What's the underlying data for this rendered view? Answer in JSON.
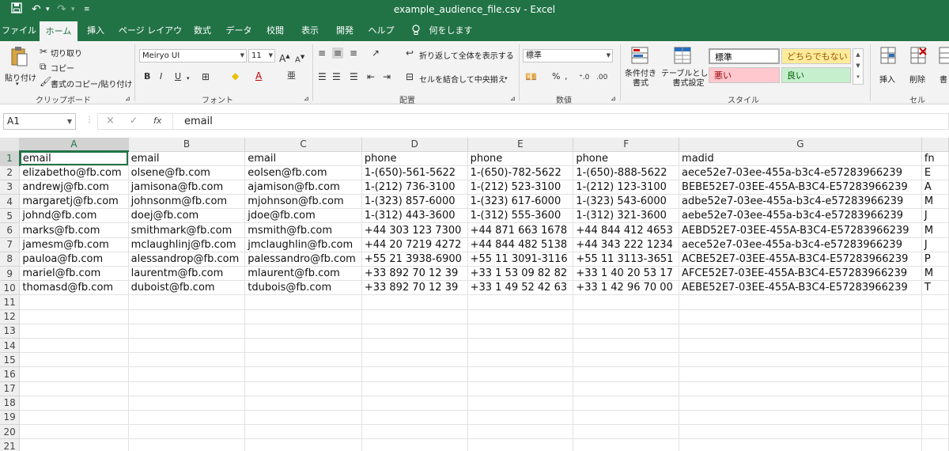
{
  "titlebar": {
    "save_icon": "save-icon",
    "undo_icon": "undo-icon",
    "redo_icon": "redo-icon",
    "title": "example_audience_file.csv  -  Excel"
  },
  "tabs": [
    "ファイル",
    "ホーム",
    "挿入",
    "ページ レイアウト",
    "数式",
    "データ",
    "校閲",
    "表示",
    "開発",
    "ヘルプ"
  ],
  "tellme": "何をしますか",
  "ribbon": {
    "clipboard": {
      "paste": "貼り付け",
      "cut": "切り取り",
      "copy": "コピー",
      "format_painter": "書式のコピー/貼り付け",
      "label": "クリップボード"
    },
    "font": {
      "name": "Meiryo UI",
      "size": "11",
      "bold": "B",
      "italic": "I",
      "underline": "U",
      "label": "フォント"
    },
    "alignment": {
      "wrap": "折り返して全体を表示する",
      "merge": "セルを結合して中央揃え",
      "label": "配置"
    },
    "number": {
      "format": "標準",
      "label": "数値"
    },
    "styles": {
      "conditional": "条件付き\n書式",
      "table": "テーブルとして\n書式設定",
      "normal": "標準",
      "neutral": "どちらでもない",
      "bad": "悪い",
      "good": "良い",
      "label": "スタイル"
    },
    "cells": {
      "insert": "挿入",
      "delete": "削除",
      "format": "書",
      "label": "セル"
    }
  },
  "formula": {
    "namebox": "A1",
    "cancel": "×",
    "enter": "✓",
    "fx": "fx",
    "value": "email"
  },
  "colors": {
    "accent": "#217346",
    "bad_bg": "#ffc7ce",
    "bad_fg": "#9c0006",
    "good_bg": "#c6efce",
    "good_fg": "#006100",
    "neutral_bg": "#ffeb9c",
    "neutral_fg": "#9c5700"
  },
  "grid": {
    "columns": [
      "A",
      "B",
      "C",
      "D",
      "E",
      "F",
      "G",
      ""
    ],
    "rows": [
      [
        "email",
        "email",
        "email",
        "phone",
        "phone",
        "phone",
        "madid",
        "fn"
      ],
      [
        "elizabetho@fb.com",
        "olsene@fb.com",
        "eolsen@fb.com",
        "1-(650)-561-5622",
        "1-(650)-782-5622",
        "1-(650)-888-5622",
        "aece52e7-03ee-455a-b3c4-e57283966239",
        "E"
      ],
      [
        "andrewj@fb.com",
        "jamisona@fb.com",
        "ajamison@fb.com",
        "1-(212) 736-3100",
        "1-(212) 523-3100",
        "1-(212) 123-3100",
        "BEBE52E7-03EE-455A-B3C4-E57283966239",
        "A"
      ],
      [
        "margaretj@fb.com",
        "johnsonm@fb.com",
        "mjohnson@fb.com",
        "1-(323) 857-6000",
        "1-(323) 617-6000",
        "1-(323) 543-6000",
        "adbe52e7-03ee-455a-b3c4-e57283966239",
        "M"
      ],
      [
        "johnd@fb.com",
        "doej@fb.com",
        "jdoe@fb.com",
        "1-(312) 443-3600",
        "1-(312) 555-3600",
        "1-(312) 321-3600",
        "aebe52e7-03ee-455a-b3c4-e57283966239",
        "J"
      ],
      [
        "marks@fb.com",
        "smithmark@fb.com",
        "msmith@fb.com",
        "+44 303 123 7300",
        "+44 871 663 1678",
        "+44 844 412 4653",
        "AEBD52E7-03EE-455A-B3C4-E57283966239",
        "M"
      ],
      [
        "jamesm@fb.com",
        "mclaughlinj@fb.com",
        "jmclaughlin@fb.com",
        "+44 20 7219 4272",
        "+44 844 482 5138",
        "+44 343 222 1234",
        "aece52e7-03ee-455a-b3c4-e57283966239",
        "J"
      ],
      [
        "pauloa@fb.com",
        "alessandrop@fb.com",
        "palessandro@fb.com",
        "+55 21 3938-6900",
        "+55 11 3091-3116",
        "+55 11 3113-3651",
        "ACBE52E7-03EE-455A-B3C4-E57283966239",
        "P"
      ],
      [
        "mariel@fb.com",
        "laurentm@fb.com",
        "mlaurent@fb.com",
        "+33 892 70 12 39",
        "+33 1 53 09 82 82",
        "+33 1 40 20 53 17",
        "AFCE52E7-03EE-455A-B3C4-E57283966239",
        "M"
      ],
      [
        "thomasd@fb.com",
        "duboist@fb.com",
        "tdubois@fb.com",
        "+33 892 70 12 39",
        "+33 1 49 52 42 63",
        "+33 1 42 96 70 00",
        "AEBE52E7-03EE-455A-B3C4-E57283966239",
        "T"
      ],
      [
        "",
        "",
        "",
        "",
        "",
        "",
        "",
        ""
      ],
      [
        "",
        "",
        "",
        "",
        "",
        "",
        "",
        ""
      ],
      [
        "",
        "",
        "",
        "",
        "",
        "",
        "",
        ""
      ],
      [
        "",
        "",
        "",
        "",
        "",
        "",
        "",
        ""
      ],
      [
        "",
        "",
        "",
        "",
        "",
        "",
        "",
        ""
      ],
      [
        "",
        "",
        "",
        "",
        "",
        "",
        "",
        ""
      ],
      [
        "",
        "",
        "",
        "",
        "",
        "",
        "",
        ""
      ],
      [
        "",
        "",
        "",
        "",
        "",
        "",
        "",
        ""
      ],
      [
        "",
        "",
        "",
        "",
        "",
        "",
        "",
        ""
      ],
      [
        "",
        "",
        "",
        "",
        "",
        "",
        "",
        ""
      ],
      [
        "",
        "",
        "",
        "",
        "",
        "",
        "",
        ""
      ]
    ]
  }
}
